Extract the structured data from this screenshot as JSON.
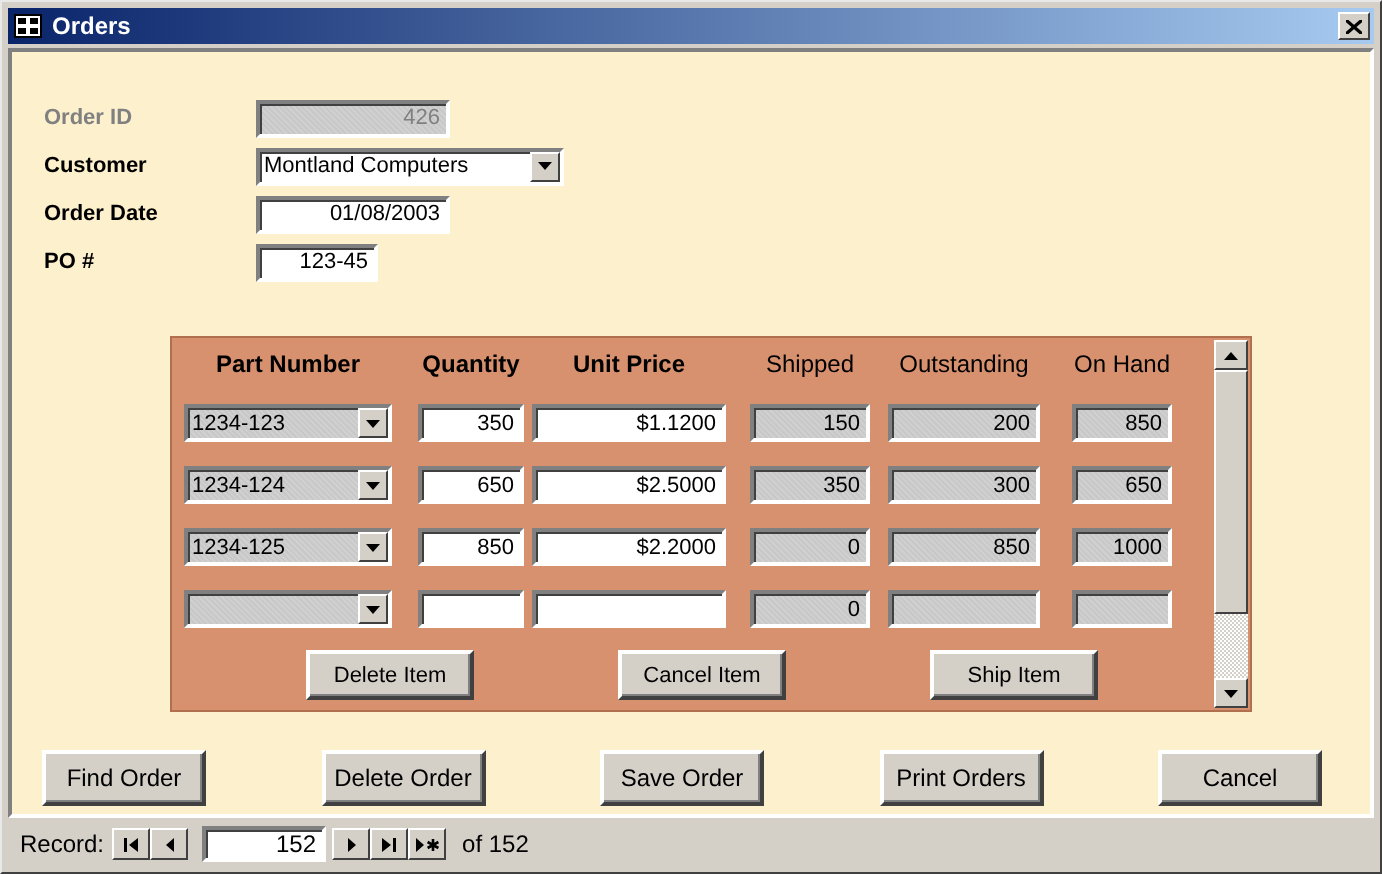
{
  "window": {
    "title": "Orders"
  },
  "fields": [
    {
      "label": "Order ID",
      "value": "426",
      "kind": "text",
      "disabled": true
    },
    {
      "label": "Customer",
      "value": "Montland Computers",
      "kind": "combo",
      "disabled": false
    },
    {
      "label": "Order Date",
      "value": "01/08/2003",
      "kind": "text",
      "disabled": false
    },
    {
      "label": "PO #",
      "value": "123-45",
      "kind": "text",
      "disabled": false
    }
  ],
  "items": {
    "columns": [
      {
        "label": "Part Number",
        "kind": "combo",
        "editable": true
      },
      {
        "label": "Quantity",
        "kind": "text",
        "editable": true
      },
      {
        "label": "Unit Price",
        "kind": "text",
        "editable": true
      },
      {
        "label": "Shipped",
        "kind": "text",
        "editable": false
      },
      {
        "label": "Outstanding",
        "kind": "text",
        "editable": false
      },
      {
        "label": "On Hand",
        "kind": "text",
        "editable": false
      }
    ],
    "rows": [
      {
        "cells": [
          "1234-123",
          "350",
          "$1.1200",
          "150",
          "200",
          "850"
        ]
      },
      {
        "cells": [
          "1234-124",
          "650",
          "$2.5000",
          "350",
          "300",
          "650"
        ]
      },
      {
        "cells": [
          "1234-125",
          "850",
          "$2.2000",
          "0",
          "850",
          "1000"
        ]
      },
      {
        "cells": [
          null,
          null,
          null,
          "0",
          null,
          null
        ]
      }
    ],
    "buttons": [
      "Delete Item",
      "Cancel Item",
      "Ship Item"
    ]
  },
  "buttons": [
    "Find Order",
    "Delete Order",
    "Save Order",
    "Print Orders",
    "Cancel"
  ],
  "navigator": {
    "label": "Record:",
    "current": "152",
    "total": "of 152"
  }
}
